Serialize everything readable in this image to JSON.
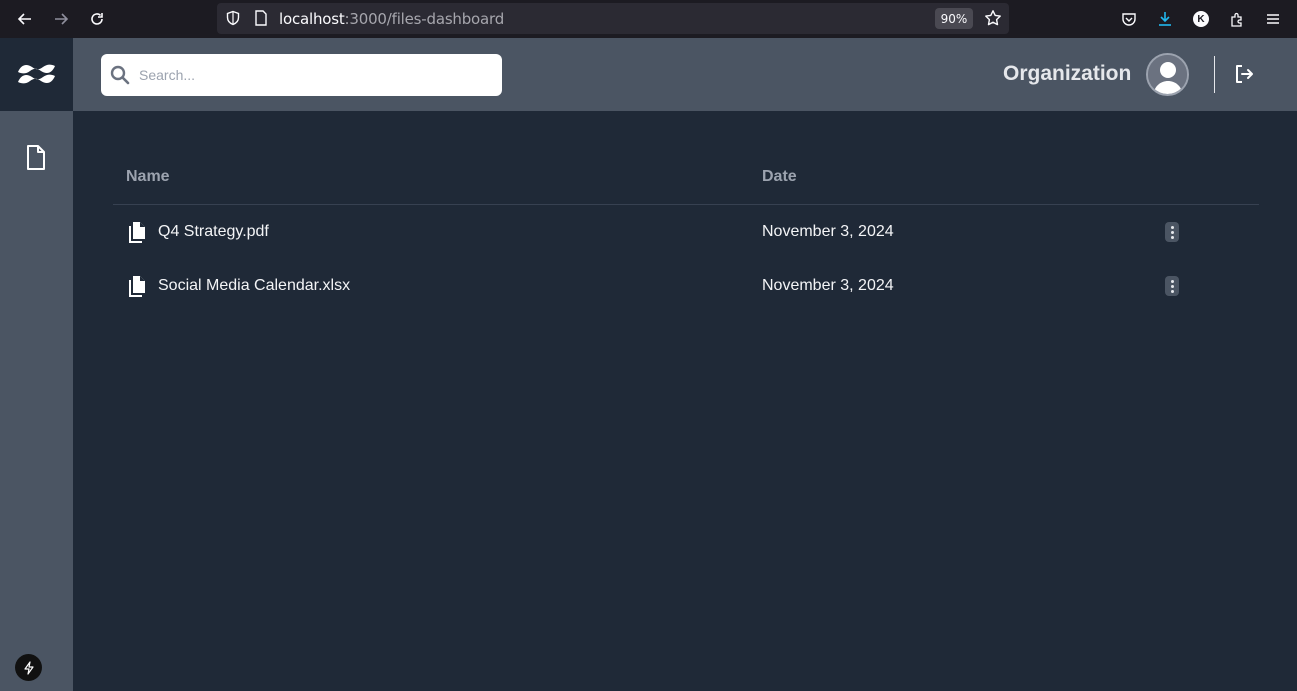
{
  "browser": {
    "url_host": "localhost",
    "url_path": ":3000/files-dashboard",
    "zoom": "90%",
    "profile_initial": "K"
  },
  "search": {
    "placeholder": "Search...",
    "value": ""
  },
  "header": {
    "organization": "Organization"
  },
  "table": {
    "columns": [
      "Name",
      "Date"
    ],
    "rows": [
      {
        "name": "Q4 Strategy.pdf",
        "date": "November 3, 2024"
      },
      {
        "name": "Social Media Calendar.xlsx",
        "date": "November 3, 2024"
      }
    ]
  },
  "colors": {
    "background": "#1f2937",
    "sidebar": "#4b5563",
    "text": "#f3f4f6",
    "muted": "#9ca3af"
  }
}
